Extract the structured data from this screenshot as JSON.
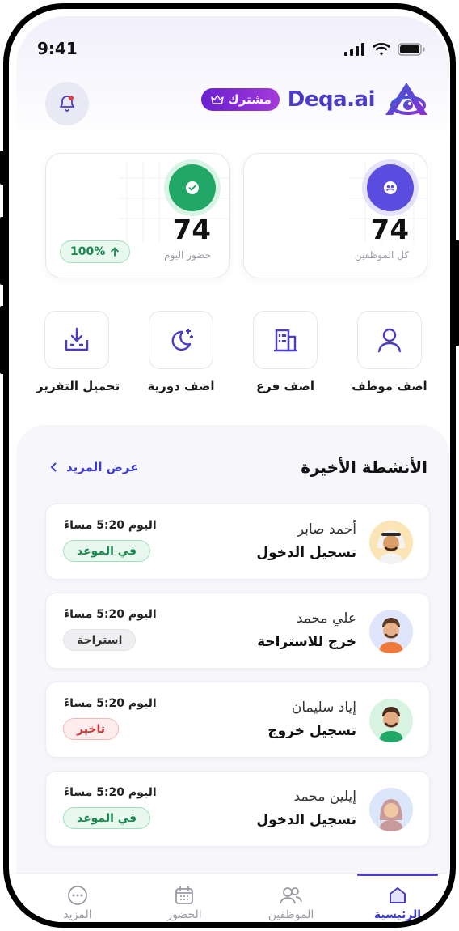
{
  "status_bar": {
    "time": "9:41"
  },
  "header": {
    "subscription_label": "مشترك",
    "brand_name": "Deqa.ai"
  },
  "stats": [
    {
      "value": "74",
      "label": "كل الموظفين"
    },
    {
      "value": "74",
      "label": "حضور اليوم",
      "trend": "100%"
    }
  ],
  "quick_actions": [
    {
      "label": "اضف موظف",
      "icon": "user-icon"
    },
    {
      "label": "اضف فرع",
      "icon": "building-icon"
    },
    {
      "label": "اضف دورية",
      "icon": "moon-stars-icon"
    },
    {
      "label": "تحميل التقرير",
      "icon": "download-tray-icon"
    }
  ],
  "activities": {
    "title": "الأنشطة الأخيرة",
    "more_label": "عرض المزيد",
    "items": [
      {
        "name": "أحمد صابر",
        "action": "تسجيل الدخول",
        "time": "اليوم 5:20 مساءً",
        "status": "في الموعد",
        "status_type": "green"
      },
      {
        "name": "علي محمد",
        "action": "خرج للاستراحة",
        "time": "اليوم 5:20 مساءً",
        "status": "استراحة",
        "status_type": "gray"
      },
      {
        "name": "إياد سليمان",
        "action": "تسجيل خروج",
        "time": "اليوم 5:20 مساءً",
        "status": "تاخير",
        "status_type": "red"
      },
      {
        "name": "إيلين محمد",
        "action": "تسجيل الدخول",
        "time": "اليوم 5:20 مساءً",
        "status": "في الموعد",
        "status_type": "green"
      }
    ]
  },
  "bottom_nav": [
    {
      "label": "الرئيسية",
      "icon": "home-icon",
      "active": true
    },
    {
      "label": "الموظفين",
      "icon": "users-icon",
      "active": false
    },
    {
      "label": "الحضور",
      "icon": "calendar-icon",
      "active": false
    },
    {
      "label": "المزيد",
      "icon": "more-dots-icon",
      "active": false
    }
  ],
  "colors": {
    "accent": "#4b3cc6",
    "success": "#17894f",
    "danger": "#d23434",
    "stat_total_icon": "#5b4ce0",
    "stat_attendance_icon": "#22a866"
  }
}
